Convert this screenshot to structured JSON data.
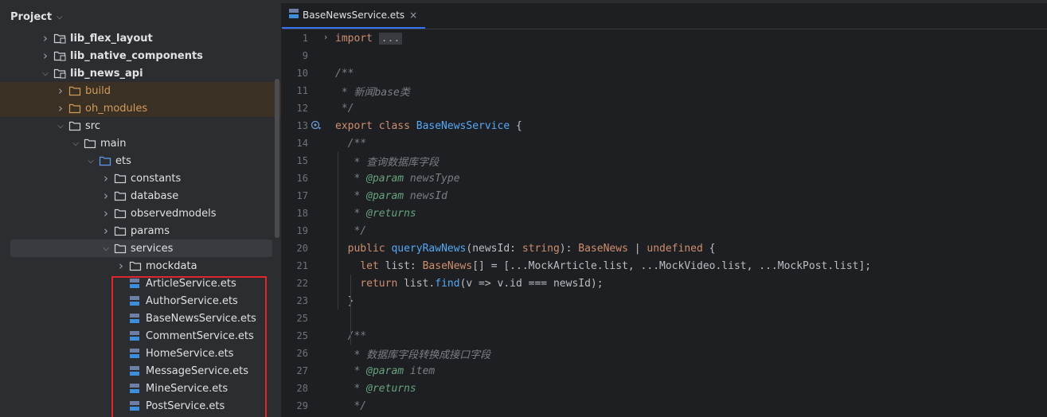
{
  "project_panel": {
    "title": "Project",
    "tree": [
      {
        "label": "lib_flex_layout",
        "indent": 1,
        "arrow": "right",
        "icon": "module",
        "style": "bold"
      },
      {
        "label": "lib_native_components",
        "indent": 1,
        "arrow": "right",
        "icon": "module",
        "style": "bold"
      },
      {
        "label": "lib_news_api",
        "indent": 1,
        "arrow": "down",
        "icon": "module",
        "style": "bold"
      },
      {
        "label": "build",
        "indent": 2,
        "arrow": "right",
        "icon": "folder-orange",
        "style": "orange",
        "excluded": true
      },
      {
        "label": "oh_modules",
        "indent": 2,
        "arrow": "right",
        "icon": "folder-orange",
        "style": "orange",
        "excluded": true
      },
      {
        "label": "src",
        "indent": 2,
        "arrow": "down",
        "icon": "folder"
      },
      {
        "label": "main",
        "indent": 3,
        "arrow": "down",
        "icon": "folder"
      },
      {
        "label": "ets",
        "indent": 4,
        "arrow": "down",
        "icon": "folder-blue"
      },
      {
        "label": "constants",
        "indent": 5,
        "arrow": "right",
        "icon": "folder"
      },
      {
        "label": "database",
        "indent": 5,
        "arrow": "right",
        "icon": "folder"
      },
      {
        "label": "observedmodels",
        "indent": 5,
        "arrow": "right",
        "icon": "folder"
      },
      {
        "label": "params",
        "indent": 5,
        "arrow": "right",
        "icon": "folder"
      },
      {
        "label": "services",
        "indent": 5,
        "arrow": "down",
        "icon": "folder",
        "selected": true
      },
      {
        "label": "mockdata",
        "indent": 6,
        "arrow": "right",
        "icon": "folder"
      },
      {
        "label": "ArticleService.ets",
        "indent": 6,
        "arrow": "none",
        "icon": "ets-file"
      },
      {
        "label": "AuthorService.ets",
        "indent": 6,
        "arrow": "none",
        "icon": "ets-file"
      },
      {
        "label": "BaseNewsService.ets",
        "indent": 6,
        "arrow": "none",
        "icon": "ets-file"
      },
      {
        "label": "CommentService.ets",
        "indent": 6,
        "arrow": "none",
        "icon": "ets-file"
      },
      {
        "label": "HomeService.ets",
        "indent": 6,
        "arrow": "none",
        "icon": "ets-file"
      },
      {
        "label": "MessageService.ets",
        "indent": 6,
        "arrow": "none",
        "icon": "ets-file"
      },
      {
        "label": "MineService.ets",
        "indent": 6,
        "arrow": "none",
        "icon": "ets-file"
      },
      {
        "label": "PostService.ets",
        "indent": 6,
        "arrow": "none",
        "icon": "ets-file"
      }
    ]
  },
  "editor": {
    "tab": {
      "label": "BaseNewsService.ets",
      "close": "×"
    },
    "lines": [
      {
        "n": "1",
        "fold": true,
        "tokens": [
          [
            "kw",
            "import"
          ],
          [
            "t",
            " "
          ],
          [
            "fold",
            "..."
          ]
        ]
      },
      {
        "n": "9",
        "tokens": []
      },
      {
        "n": "10",
        "tokens": [
          [
            "cmt",
            "/**"
          ]
        ]
      },
      {
        "n": "11",
        "tokens": [
          [
            "cmt",
            " * 新闻base类"
          ]
        ]
      },
      {
        "n": "12",
        "tokens": [
          [
            "cmt",
            " */"
          ]
        ]
      },
      {
        "n": "13",
        "impl": true,
        "tokens": [
          [
            "kw",
            "export class "
          ],
          [
            "cls",
            "BaseNewsService"
          ],
          [
            "t",
            " {"
          ]
        ]
      },
      {
        "n": "14",
        "tokens": [
          [
            "cmt",
            "  /**"
          ]
        ]
      },
      {
        "n": "15",
        "tokens": [
          [
            "cmt",
            "   * 查询数据库字段"
          ]
        ]
      },
      {
        "n": "16",
        "tokens": [
          [
            "cmt",
            "   * "
          ],
          [
            "tag",
            "@param"
          ],
          [
            "cmt",
            " newsType"
          ]
        ]
      },
      {
        "n": "17",
        "tokens": [
          [
            "cmt",
            "   * "
          ],
          [
            "tag",
            "@param"
          ],
          [
            "cmt",
            " newsId"
          ]
        ]
      },
      {
        "n": "18",
        "tokens": [
          [
            "cmt",
            "   * "
          ],
          [
            "tag",
            "@returns"
          ]
        ]
      },
      {
        "n": "19",
        "tokens": [
          [
            "cmt",
            "   */"
          ]
        ]
      },
      {
        "n": "20",
        "tokens": [
          [
            "t",
            "  "
          ],
          [
            "kw",
            "public "
          ],
          [
            "fn",
            "queryRawNews"
          ],
          [
            "t",
            "(newsId: "
          ],
          [
            "kw",
            "string"
          ],
          [
            "t",
            "): "
          ],
          [
            "kw",
            "BaseNews"
          ],
          [
            "t",
            " | "
          ],
          [
            "kw",
            "undefined"
          ],
          [
            "t",
            " {"
          ]
        ]
      },
      {
        "n": "21",
        "tokens": [
          [
            "t",
            "    "
          ],
          [
            "kw",
            "let "
          ],
          [
            "t",
            "list: "
          ],
          [
            "kw",
            "BaseNews"
          ],
          [
            "t",
            "[] = [..."
          ],
          [
            "t",
            "MockArticle.list, ...MockVideo.list, ...MockPost.list];"
          ]
        ]
      },
      {
        "n": "22",
        "tokens": [
          [
            "t",
            "    "
          ],
          [
            "kw",
            "return "
          ],
          [
            "t",
            "list."
          ],
          [
            "fn",
            "find"
          ],
          [
            "t",
            "(v => v.id === newsId);"
          ]
        ]
      },
      {
        "n": "23",
        "tokens": [
          [
            "t",
            "  }"
          ]
        ]
      },
      {
        "n": "25",
        "tokens": []
      },
      {
        "n": "25",
        "tokens": [
          [
            "cmt",
            "  /**"
          ]
        ]
      },
      {
        "n": "26",
        "tokens": [
          [
            "cmt",
            "   * 数据库字段转换成接口字段"
          ]
        ]
      },
      {
        "n": "27",
        "tokens": [
          [
            "cmt",
            "   * "
          ],
          [
            "tag",
            "@param"
          ],
          [
            "cmt",
            " item"
          ]
        ]
      },
      {
        "n": "28",
        "tokens": [
          [
            "cmt",
            "   * "
          ],
          [
            "tag",
            "@returns"
          ]
        ]
      },
      {
        "n": "29",
        "tokens": [
          [
            "cmt",
            "   */"
          ]
        ]
      }
    ]
  }
}
